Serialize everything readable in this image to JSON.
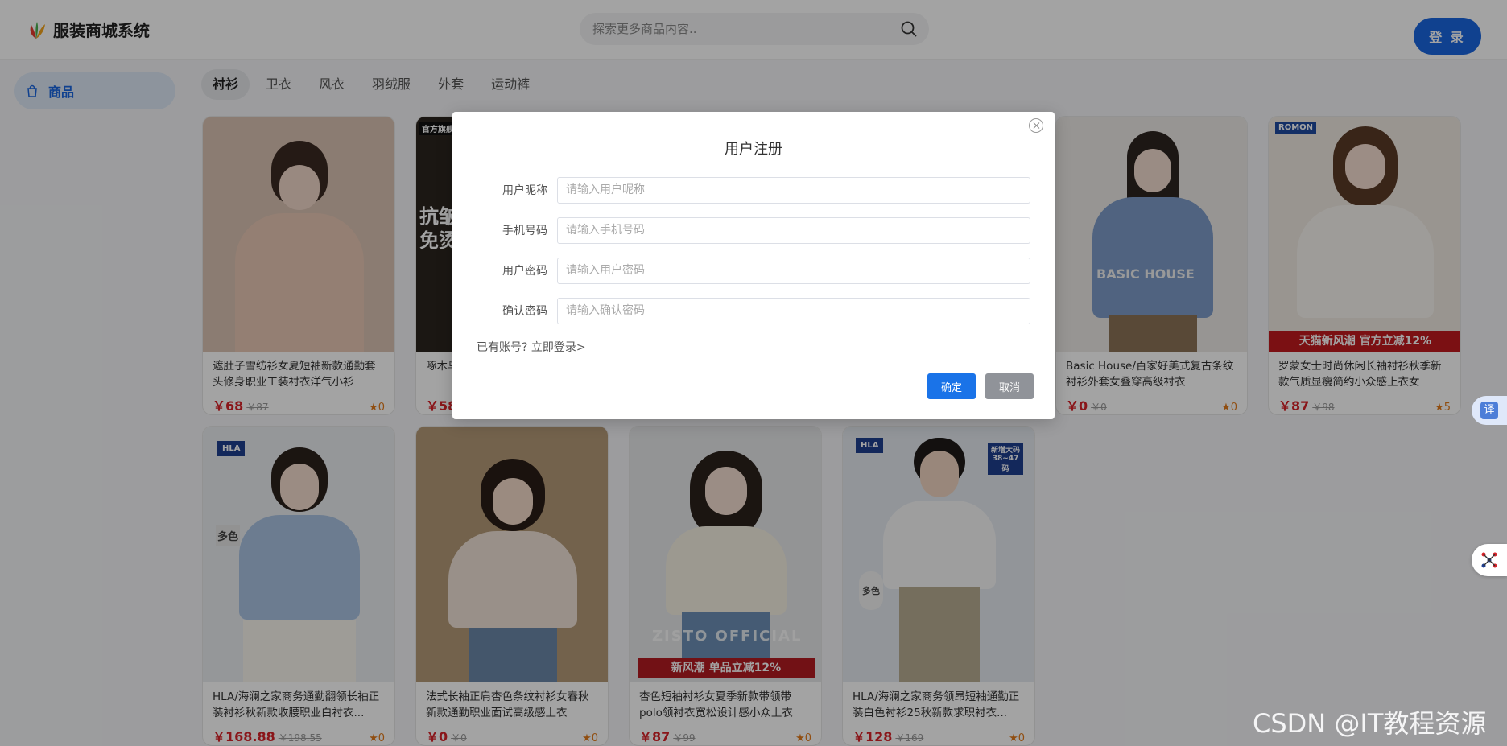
{
  "app": {
    "title": "服装商城系统"
  },
  "search": {
    "placeholder": "探索更多商品内容.."
  },
  "header": {
    "login_label": "登 录"
  },
  "sidebar": {
    "items": [
      {
        "label": "商品"
      }
    ]
  },
  "tabs": [
    "衬衫",
    "卫衣",
    "风衣",
    "羽绒服",
    "外套",
    "运动裤"
  ],
  "products": [
    {
      "title": "遮肚子雪纺衫女夏短袖新款通勤套头修身职业工装衬衣洋气小衫",
      "price": "￥68",
      "orig": "￥87",
      "stars": "★0",
      "bg": "#d9c2b3"
    },
    {
      "title": "啄木鸟正装衬衫",
      "price": "￥58",
      "orig": "",
      "stars": "",
      "bg": "#2b241f"
    },
    {
      "title": "Basic House/百家好美式复古条纹衬衫外套女叠穿高级衬衣",
      "price": "￥0",
      "orig": "￥0",
      "stars": "★0",
      "bg": "#eceae6"
    },
    {
      "title": "罗蒙女士时尚休闲长袖衬衫秋季新款气质显瘦简约小众感上衣女",
      "price": "￥87",
      "orig": "￥98",
      "stars": "★5",
      "bg": "#efe9e1"
    },
    {
      "title": "HLA/海澜之家商务通勤翻领长袖正装衬衫秋新款收腰职业白衬衣...",
      "price": "￥168.88",
      "orig": "￥198.55",
      "stars": "★0",
      "bg": "#e9ecf0"
    },
    {
      "title": "法式长袖正肩杏色条纹衬衫女春秋新款通勤职业面试高级感上衣",
      "price": "￥0",
      "orig": "￥0",
      "stars": "★0",
      "bg": "#b59a78"
    },
    {
      "title": "杏色短袖衬衫女夏季新款带领带polo领衬衣宽松设计感小众上衣",
      "price": "￥87",
      "orig": "￥99",
      "stars": "★0",
      "bg": "#e6e8ea"
    },
    {
      "title": "HLA/海澜之家商务领昂短袖通勤正装白色衬衫25秋新款求职衬衣...",
      "price": "￥128",
      "orig": "￥169",
      "stars": "★0",
      "bg": "#e4eaf0"
    }
  ],
  "card_labels": {
    "official_store": "官方旗舰",
    "anti_wrinkle": "抗皱",
    "free_iron": "免烫",
    "basic_house": "BASIC HOUSE",
    "romon": "ROMON",
    "tmall_banner": "天猫新风潮 官方立减12%",
    "hla": "HLA",
    "multi_color": "多色",
    "zisto": "ZISTO OFFICIAL",
    "new_trend": "新风潮 单品立减12%",
    "size_badge": "新增大码 38~47码"
  },
  "modal": {
    "title": "用户注册",
    "fields": [
      {
        "label": "用户昵称",
        "placeholder": "请输入用户昵称"
      },
      {
        "label": "手机号码",
        "placeholder": "请输入手机号码"
      },
      {
        "label": "用户密码",
        "placeholder": "请输入用户密码"
      },
      {
        "label": "确认密码",
        "placeholder": "请输入确认密码"
      }
    ],
    "login_prompt": "已有账号?",
    "login_link": "立即登录>",
    "confirm_label": "确定",
    "cancel_label": "取消"
  },
  "widgets": {
    "translate_label": "译"
  },
  "watermark": "CSDN @IT教程资源"
}
